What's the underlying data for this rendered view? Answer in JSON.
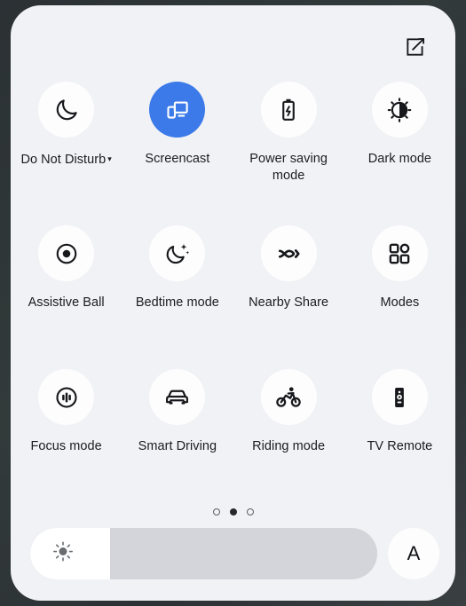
{
  "panel": {
    "background_color": "#f1f2f5",
    "accent_color": "#3b7ae8"
  },
  "header": {
    "edit_button": {
      "icon": "edit-square-pencil-icon",
      "label": "Edit"
    }
  },
  "tiles": [
    {
      "id": "do-not-disturb",
      "label": "Do Not Disturb",
      "icon": "moon-icon",
      "active": false,
      "has_dropdown": true,
      "caret": "▾"
    },
    {
      "id": "screencast",
      "label": "Screencast",
      "icon": "screencast-icon",
      "active": true,
      "has_dropdown": false,
      "caret": ""
    },
    {
      "id": "power-saving-mode",
      "label": "Power saving mode",
      "icon": "battery-bolt-icon",
      "active": false,
      "has_dropdown": false,
      "caret": ""
    },
    {
      "id": "dark-mode",
      "label": "Dark mode",
      "icon": "brightness-contrast-icon",
      "active": false,
      "has_dropdown": false,
      "caret": ""
    },
    {
      "id": "assistive-ball",
      "label": "Assistive Ball",
      "icon": "target-dot-icon",
      "active": false,
      "has_dropdown": false,
      "caret": ""
    },
    {
      "id": "bedtime-mode",
      "label": "Bedtime mode",
      "icon": "moon-stars-icon",
      "active": false,
      "has_dropdown": false,
      "caret": ""
    },
    {
      "id": "nearby-share",
      "label": "Nearby Share",
      "icon": "nearby-share-icon",
      "active": false,
      "has_dropdown": false,
      "caret": ""
    },
    {
      "id": "modes",
      "label": "Modes",
      "icon": "grid-modes-icon",
      "active": false,
      "has_dropdown": false,
      "caret": ""
    },
    {
      "id": "focus-mode",
      "label": "Focus mode",
      "icon": "focus-equalizer-icon",
      "active": false,
      "has_dropdown": false,
      "caret": ""
    },
    {
      "id": "smart-driving",
      "label": "Smart Driving",
      "icon": "car-icon",
      "active": false,
      "has_dropdown": false,
      "caret": ""
    },
    {
      "id": "riding-mode",
      "label": "Riding mode",
      "icon": "bicycle-icon",
      "active": false,
      "has_dropdown": false,
      "caret": ""
    },
    {
      "id": "tv-remote",
      "label": "TV Remote",
      "icon": "tv-remote-icon",
      "active": false,
      "has_dropdown": false,
      "caret": ""
    }
  ],
  "pager": {
    "total_pages": 3,
    "current_page": 2
  },
  "brightness": {
    "icon": "sun-icon",
    "value_percent": 23,
    "auto_label": "A",
    "auto_icon": "auto-brightness-letter-a"
  }
}
